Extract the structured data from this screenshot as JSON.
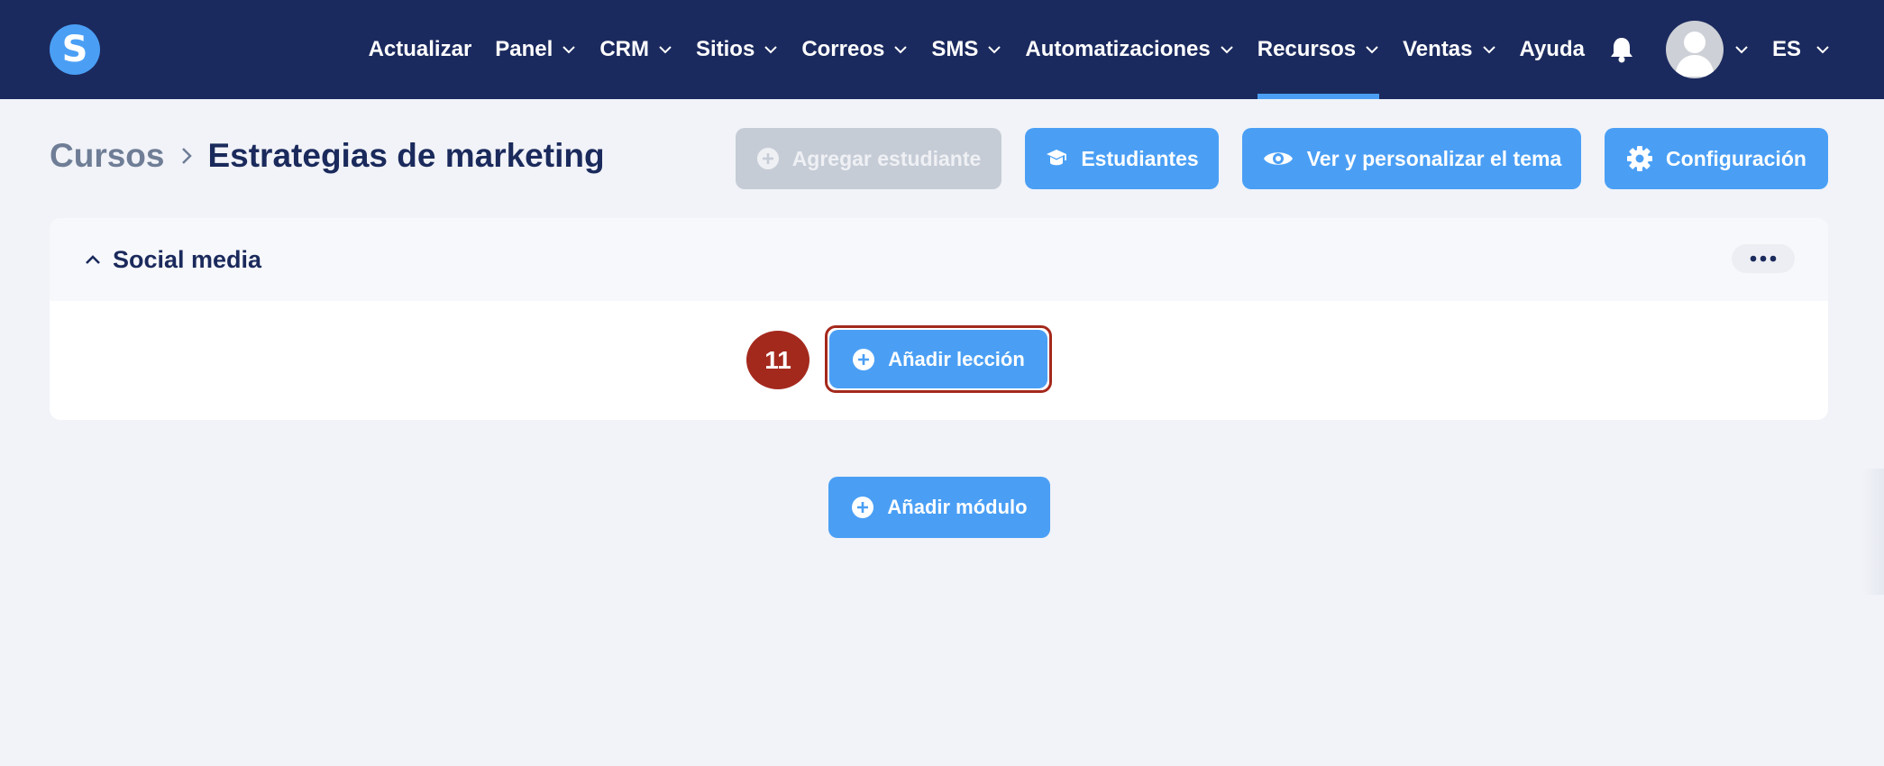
{
  "brand": {
    "logo_letter": "S"
  },
  "nav": {
    "items": [
      {
        "label": "Actualizar",
        "dropdown": false,
        "active": false
      },
      {
        "label": "Panel",
        "dropdown": true,
        "active": false
      },
      {
        "label": "CRM",
        "dropdown": true,
        "active": false
      },
      {
        "label": "Sitios",
        "dropdown": true,
        "active": false
      },
      {
        "label": "Correos",
        "dropdown": true,
        "active": false
      },
      {
        "label": "SMS",
        "dropdown": true,
        "active": false
      },
      {
        "label": "Automatizaciones",
        "dropdown": true,
        "active": false
      },
      {
        "label": "Recursos",
        "dropdown": true,
        "active": true
      },
      {
        "label": "Ventas",
        "dropdown": true,
        "active": false
      },
      {
        "label": "Ayuda",
        "dropdown": false,
        "active": false
      }
    ],
    "language": "ES"
  },
  "breadcrumb": {
    "root": "Cursos",
    "current": "Estrategias de marketing"
  },
  "actions": {
    "add_student": "Agregar estudiante",
    "students": "Estudiantes",
    "theme": "Ver y personalizar el tema",
    "settings": "Configuración"
  },
  "module": {
    "title": "Social media",
    "add_lesson": "Añadir lección"
  },
  "step": {
    "number": "11"
  },
  "add_module": "Añadir módulo",
  "colors": {
    "navbar": "#1b2a5e",
    "accent": "#4a9ff5",
    "step_badge": "#a4291d",
    "disabled": "#c6ccd6"
  }
}
